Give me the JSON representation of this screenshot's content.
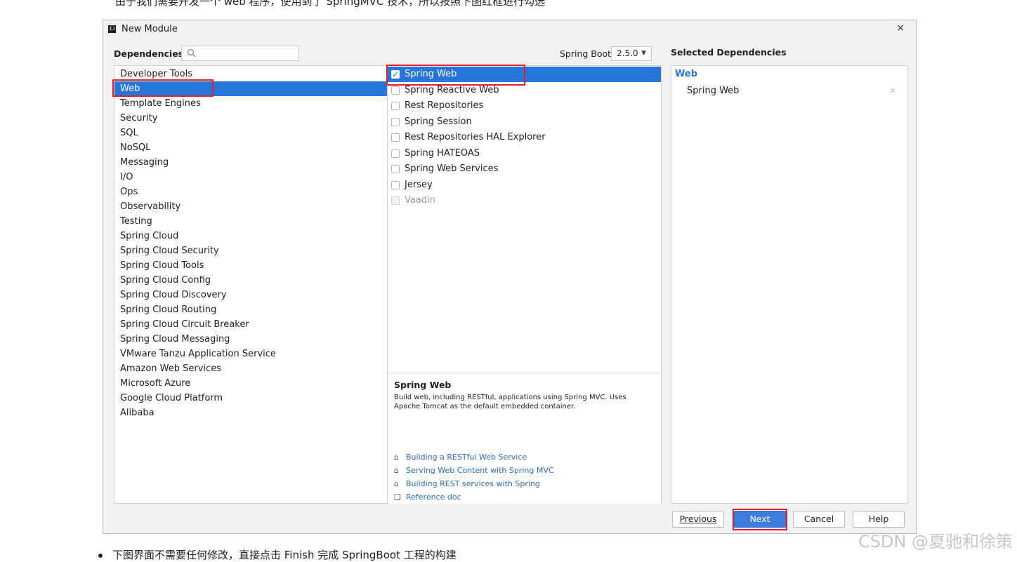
{
  "article": {
    "top_text": "由于我们需要开发一个 web 程序，使用到了 SpringMVC 技术，所以按照下图红框进行勾选",
    "bottom_text": "下图界面不需要任何修改，直接点击 Finish 完成 SpringBoot 工程的构建",
    "watermark": "CSDN @夏驰和徐策"
  },
  "dialog": {
    "title": "New Module",
    "close_glyph": "×",
    "dependencies_label": "Dependencies",
    "search": {
      "value": "",
      "placeholder": ""
    },
    "spring_boot_label": "Spring Boot",
    "spring_boot_version": "2.5.0",
    "selected_dependencies_title": "Selected Dependencies"
  },
  "categories": [
    "Developer Tools",
    "Web",
    "Template Engines",
    "Security",
    "SQL",
    "NoSQL",
    "Messaging",
    "I/O",
    "Ops",
    "Observability",
    "Testing",
    "Spring Cloud",
    "Spring Cloud Security",
    "Spring Cloud Tools",
    "Spring Cloud Config",
    "Spring Cloud Discovery",
    "Spring Cloud Routing",
    "Spring Cloud Circuit Breaker",
    "Spring Cloud Messaging",
    "VMware Tanzu Application Service",
    "Amazon Web Services",
    "Microsoft Azure",
    "Google Cloud Platform",
    "Alibaba"
  ],
  "selected_category": "Web",
  "dependencies": [
    {
      "label": "Spring Web",
      "checked": true,
      "selected": true,
      "disabled": false
    },
    {
      "label": "Spring Reactive Web",
      "checked": false,
      "selected": false,
      "disabled": false
    },
    {
      "label": "Rest Repositories",
      "checked": false,
      "selected": false,
      "disabled": false
    },
    {
      "label": "Spring Session",
      "checked": false,
      "selected": false,
      "disabled": false
    },
    {
      "label": "Rest Repositories HAL Explorer",
      "checked": false,
      "selected": false,
      "disabled": false
    },
    {
      "label": "Spring HATEOAS",
      "checked": false,
      "selected": false,
      "disabled": false
    },
    {
      "label": "Spring Web Services",
      "checked": false,
      "selected": false,
      "disabled": false
    },
    {
      "label": "Jersey",
      "checked": false,
      "selected": false,
      "disabled": false
    },
    {
      "label": "Vaadin",
      "checked": false,
      "selected": false,
      "disabled": true
    }
  ],
  "description": {
    "title": "Spring Web",
    "text": "Build web, including RESTful, applications using Spring MVC. Uses Apache Tomcat as the default embedded container.",
    "links": [
      {
        "icon": "home-icon",
        "label": "Building a RESTful Web Service"
      },
      {
        "icon": "home-icon",
        "label": "Serving Web Content with Spring MVC"
      },
      {
        "icon": "home-icon",
        "label": "Building REST services with Spring"
      },
      {
        "icon": "book-icon",
        "label": "Reference doc"
      }
    ]
  },
  "selected": {
    "group": "Web",
    "items": [
      "Spring Web"
    ],
    "remove_glyph": "×"
  },
  "buttons": {
    "previous": "Previous",
    "next": "Next",
    "cancel": "Cancel",
    "help": "Help"
  },
  "colors": {
    "accent": "#2675d8",
    "highlight_box": "#e0202a",
    "link": "#2a6bc2"
  }
}
